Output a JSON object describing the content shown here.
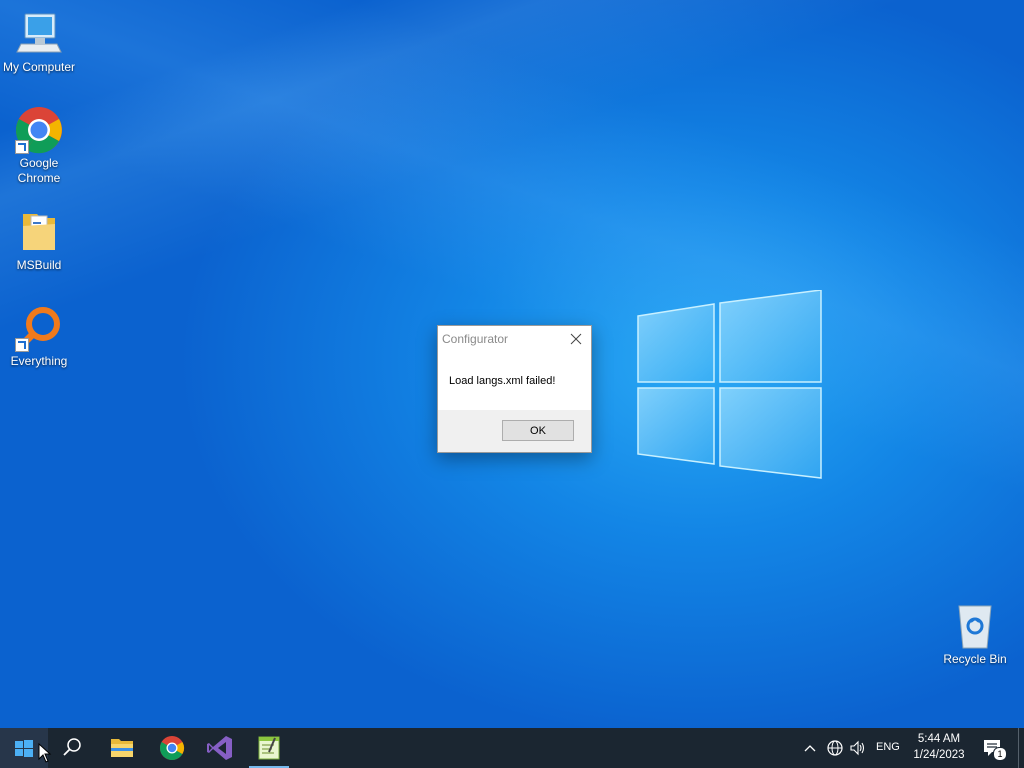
{
  "desktop": {
    "icons": [
      {
        "label": "My Computer"
      },
      {
        "label": "Google Chrome"
      },
      {
        "label": "MSBuild"
      },
      {
        "label": "Everything"
      },
      {
        "label": "Recycle Bin"
      }
    ]
  },
  "dialog": {
    "title": "Configurator",
    "message": "Load langs.xml failed!",
    "ok_label": "OK"
  },
  "taskbar": {
    "pinned": [
      "start-icon",
      "search-icon",
      "file-explorer-icon",
      "chrome-icon",
      "visual-studio-icon",
      "notepad-plus-icon"
    ],
    "language": "ENG",
    "time": "5:44 AM",
    "date": "1/24/2023",
    "notification_count": "1"
  },
  "colors": {
    "wallpaper": "#1386e6",
    "taskbar": "#1b2631",
    "accent": "#76b9ed"
  }
}
